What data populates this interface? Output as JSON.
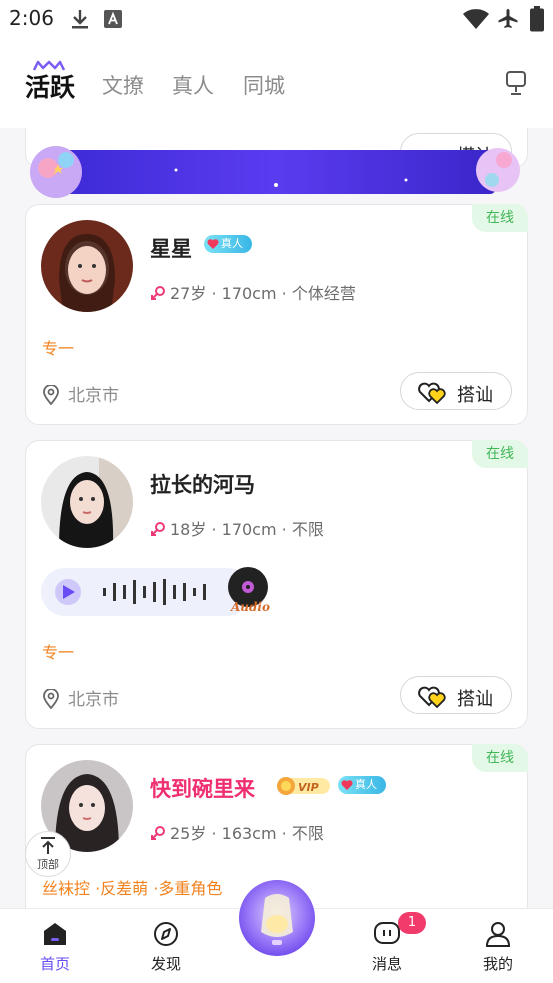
{
  "status_bar": {
    "time": "2:06"
  },
  "top_tabs": [
    {
      "label": "活跃",
      "active": true
    },
    {
      "label": "文撩",
      "active": false
    },
    {
      "label": "真人",
      "active": false
    },
    {
      "label": "同城",
      "active": false
    }
  ],
  "partial_top_button": "搭讪",
  "cards": [
    {
      "name": "星星",
      "online_label": "在线",
      "real_badge": "真人",
      "info_age": "27岁",
      "info_rest": " · 170cm · 个体经营",
      "tags": "专一",
      "location": "北京市",
      "chat_label": "搭讪"
    },
    {
      "name": "拉长的河马",
      "online_label": "在线",
      "info_age": "18岁",
      "info_rest": " · 170cm · 不限",
      "audio_label": "Audio",
      "tags": "专一",
      "location": "北京市",
      "chat_label": "搭讪"
    },
    {
      "name": "快到碗里来",
      "online_label": "在线",
      "vip_badge": "VIP",
      "real_badge": "真人",
      "info_age": "25岁",
      "info_rest": " · 163cm · 不限",
      "tags": "丝袜控 ·反差萌 ·多重角色"
    }
  ],
  "back_to_top": "顶部",
  "bottom_nav": [
    {
      "label": "首页",
      "active": true
    },
    {
      "label": "发现",
      "active": false
    },
    {
      "label": "消息",
      "active": false,
      "badge": "1"
    },
    {
      "label": "我的",
      "active": false
    }
  ],
  "colors": {
    "accent": "#6a4cf5",
    "online": "#43b657",
    "tag": "#f2821e",
    "vip_name": "#ef2f72"
  }
}
